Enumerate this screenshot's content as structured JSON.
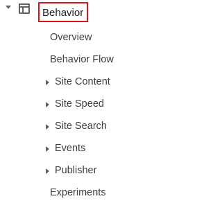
{
  "section": {
    "label": "Behavior",
    "icon": "behavior-icon",
    "expanded": true,
    "highlight_color": "#e0111b"
  },
  "items": [
    {
      "label": "Overview",
      "expandable": false
    },
    {
      "label": "Behavior Flow",
      "expandable": false
    },
    {
      "label": "Site Content",
      "expandable": true
    },
    {
      "label": "Site Speed",
      "expandable": true
    },
    {
      "label": "Site Search",
      "expandable": true
    },
    {
      "label": "Events",
      "expandable": true
    },
    {
      "label": "Publisher",
      "expandable": true
    },
    {
      "label": "Experiments",
      "expandable": false
    }
  ]
}
